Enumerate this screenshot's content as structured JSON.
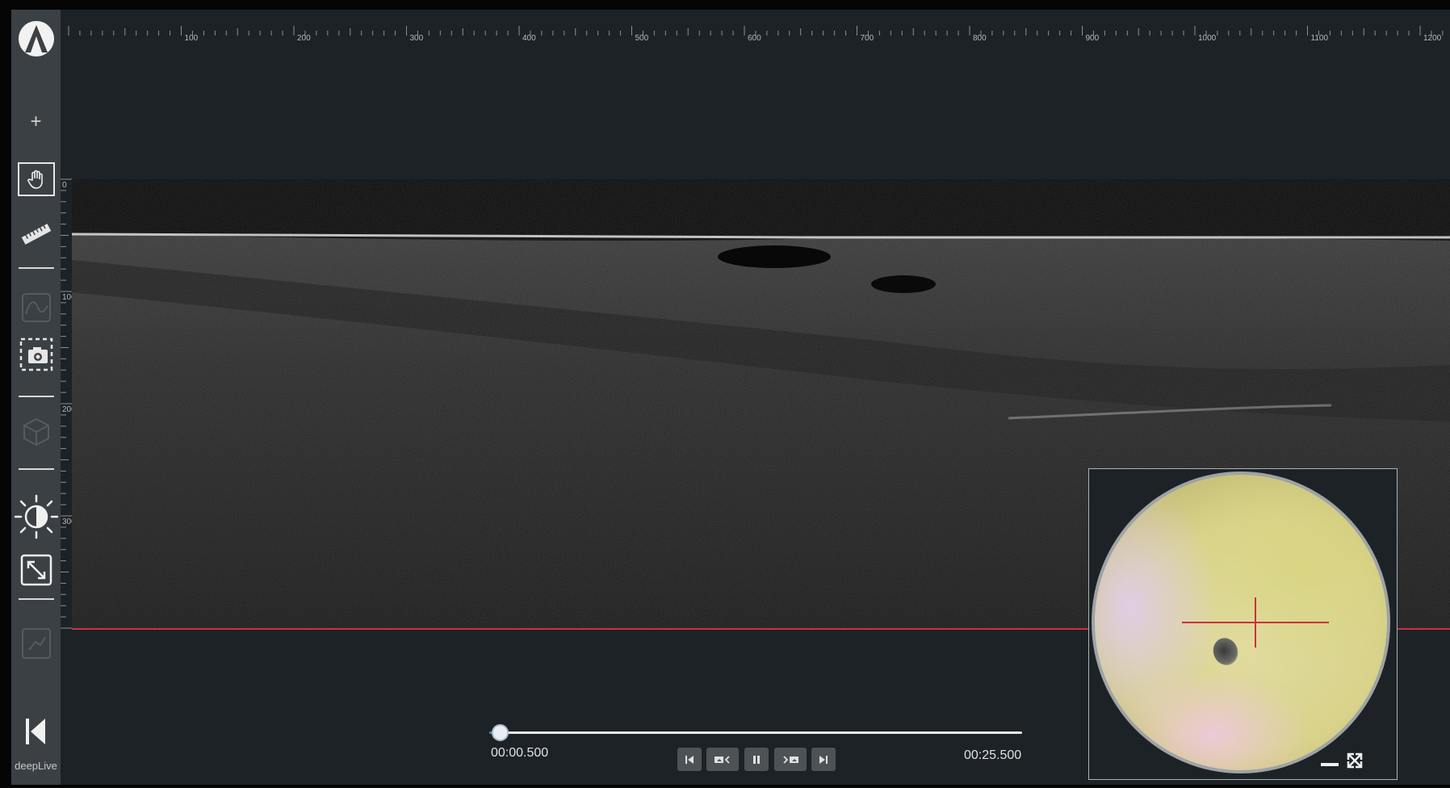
{
  "brand": {
    "footer_logo": "deepLive"
  },
  "toolbar": {
    "add": "+",
    "tools": [
      "add-icon",
      "hand-pan-icon",
      "ruler-icon",
      "profile-curve-icon",
      "snapshot-icon",
      "cube-3d-icon",
      "brightness-icon",
      "expand-icon",
      "report-icon",
      "first-frame-icon"
    ],
    "active_tool": "hand-pan-icon"
  },
  "ruler": {
    "horizontal_labels": [
      "100",
      "200",
      "300",
      "400",
      "500",
      "600",
      "700",
      "800",
      "900",
      "1000",
      "1100",
      "1200"
    ],
    "vertical_labels": [
      "0",
      "100",
      "200",
      "300"
    ]
  },
  "player": {
    "current_time": "00:00.500",
    "total_time": "00:25.500",
    "progress": 0.02,
    "buttons": [
      "skip-start-icon",
      "prev-frame-icon",
      "pause-icon",
      "next-frame-icon",
      "skip-end-icon"
    ]
  },
  "dermoscopy": {
    "buttons": [
      "minimize-icon",
      "fullscreen-icon"
    ]
  },
  "colors": {
    "accent_red": "#c8323f",
    "background": "#1d2226",
    "sidebar": "#3b4045",
    "progress_blue": "#3a7bd5"
  }
}
